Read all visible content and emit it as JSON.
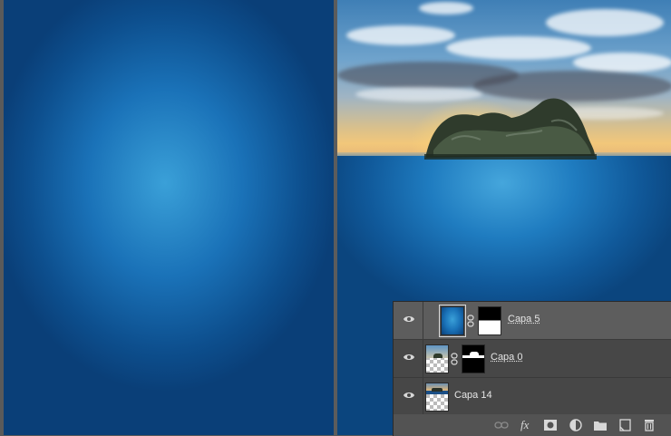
{
  "layers": [
    {
      "name": "Capa 5",
      "selected": true,
      "has_mask": true,
      "visible": true
    },
    {
      "name": "Capa 0",
      "selected": false,
      "has_mask": true,
      "visible": true
    },
    {
      "name": "Capa 14",
      "selected": false,
      "has_mask": false,
      "visible": true
    }
  ],
  "toolbar": {
    "fx_label": "fx",
    "icons": [
      "link-layers-icon",
      "fx-icon",
      "add-mask-icon",
      "adjustment-layer-icon",
      "new-group-icon",
      "new-layer-icon",
      "trash-icon"
    ]
  },
  "colors": {
    "panel_bg": "#535353",
    "selected_row": "#5d5d5d",
    "row_bg": "#474747",
    "water_blue": "#1a72b8"
  }
}
